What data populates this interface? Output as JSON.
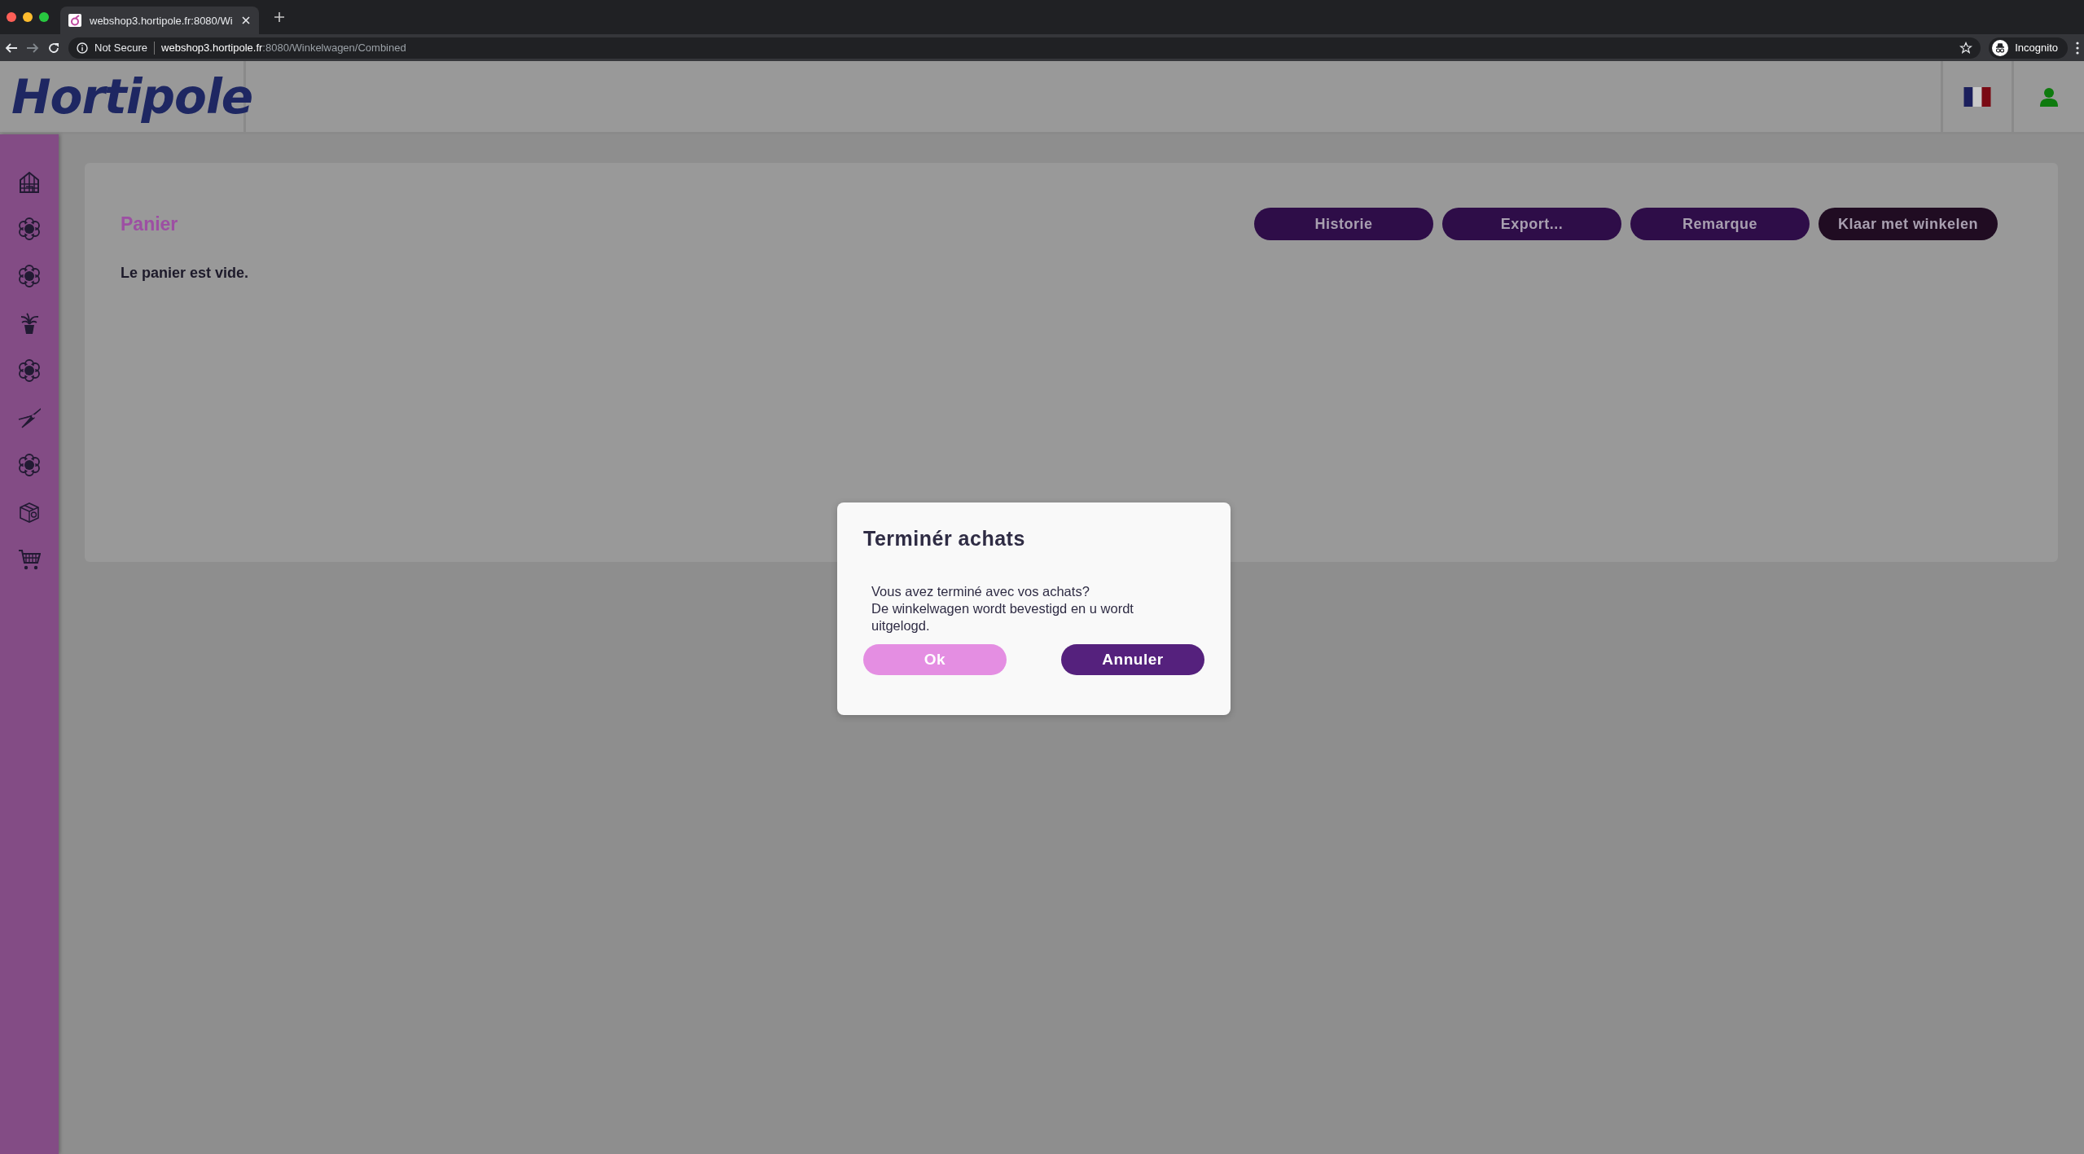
{
  "browser": {
    "tabs": [
      {
        "title": "webshop3.hortipole.fr:8080/Wi",
        "selected": true
      }
    ],
    "address": {
      "security": "Not Secure",
      "host": "webshop3.hortipole.fr",
      "path": ":8080/Winkelwagen/Combined"
    },
    "profile": "Incognito"
  },
  "header": {
    "logo": "Hortipole"
  },
  "sidebar": {
    "items": [
      {
        "kind": "greenhouse"
      },
      {
        "kind": "flower"
      },
      {
        "kind": "flower"
      },
      {
        "kind": "plant"
      },
      {
        "kind": "flower"
      },
      {
        "kind": "pruner"
      },
      {
        "kind": "flower"
      },
      {
        "kind": "box"
      },
      {
        "kind": "cart"
      }
    ]
  },
  "cart": {
    "title": "Panier",
    "buttons": [
      {
        "label": "Historie",
        "kind": "default"
      },
      {
        "label": "Export...",
        "kind": "default"
      },
      {
        "label": "Remarque",
        "kind": "default"
      },
      {
        "label": "Klaar met winkelen",
        "kind": "primary"
      }
    ],
    "message": "Le panier est vide."
  },
  "dialog": {
    "title": "Terminér achats",
    "lines": [
      "Vous avez terminé avec vos achats?",
      "De winkelwagen wordt bevestigd en u wordt uitgelogd."
    ],
    "buttons": [
      {
        "label": "Ok",
        "kind": "confirm"
      },
      {
        "label": "Annuler",
        "kind": "cancel"
      }
    ]
  }
}
